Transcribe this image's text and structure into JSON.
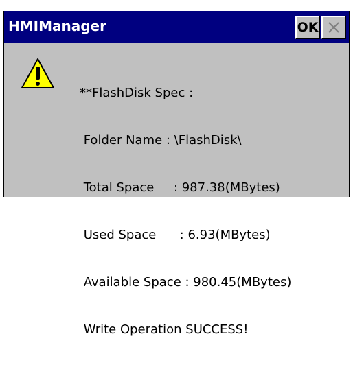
{
  "window": {
    "title": "HMIManager",
    "ok_label": "OK",
    "close_icon": "close-icon"
  },
  "dialog": {
    "icon": "warning-icon",
    "lines": [
      "**FlashDisk Spec :",
      " Folder Name : \\FlashDisk\\",
      " Total Space     : 987.38(MBytes)",
      " Used Space      : 6.93(MBytes)",
      " Available Space : 980.45(MBytes)",
      " Write Operation SUCCESS!"
    ]
  },
  "colors": {
    "titlebar": "#000080",
    "window_bg": "#c0c0c0",
    "warning_fill": "#ffff00"
  }
}
